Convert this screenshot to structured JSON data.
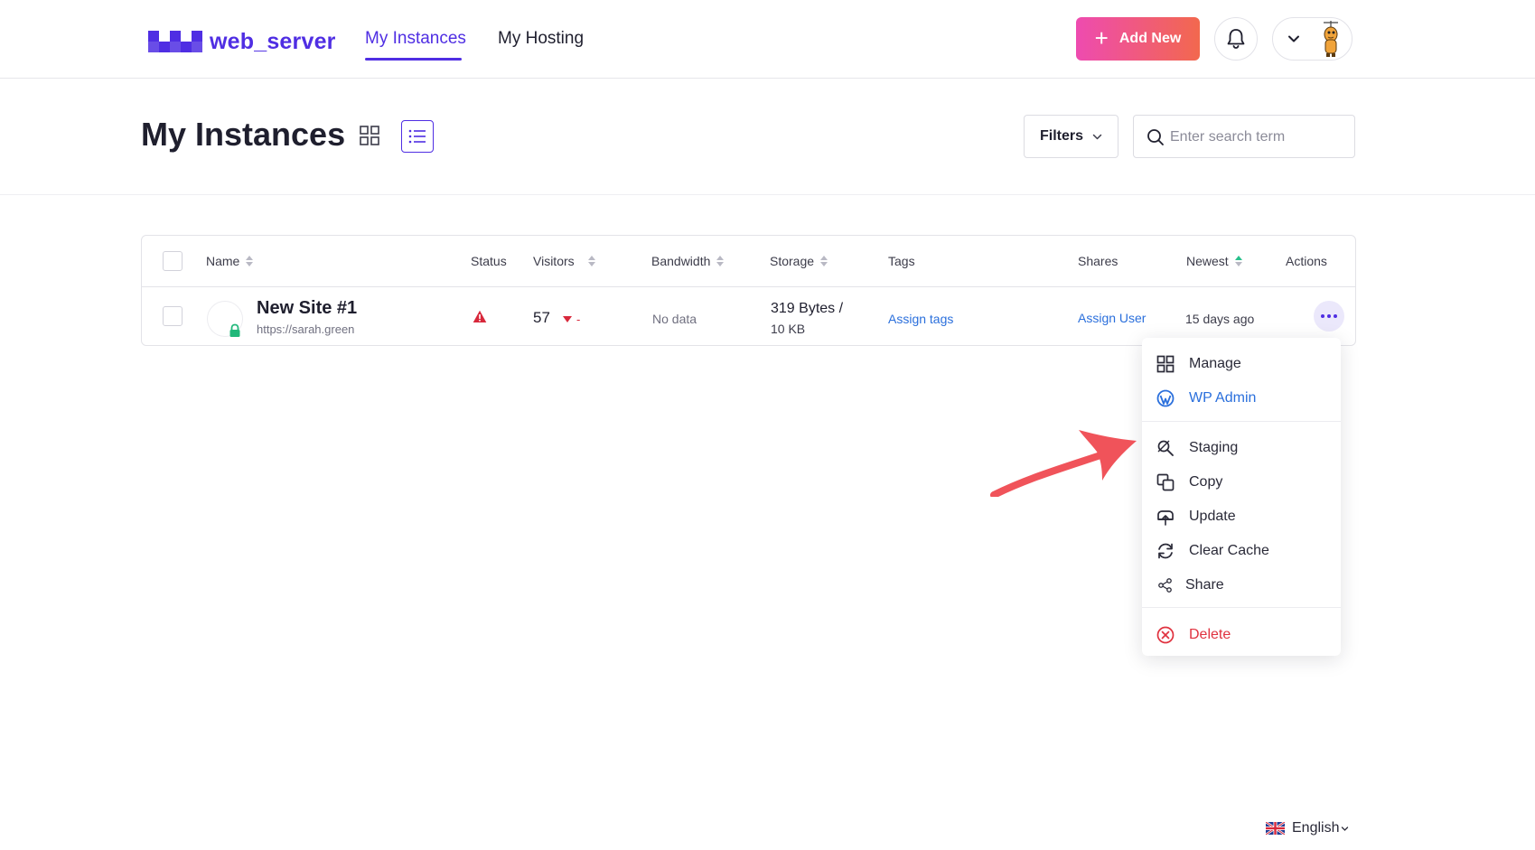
{
  "header": {
    "logo_text": "web_server",
    "tabs": [
      {
        "label": "My Instances",
        "active": true
      },
      {
        "label": "My Hosting",
        "active": false
      }
    ],
    "add_button_label": "Add New",
    "accent_color": "#4f2ee3"
  },
  "page": {
    "title": "My Instances",
    "filters_label": "Filters",
    "search_placeholder": "Enter search term"
  },
  "table": {
    "columns": [
      "Name",
      "Status",
      "Visitors",
      "Bandwidth",
      "Storage",
      "Tags",
      "Shares",
      "Newest",
      "Actions"
    ],
    "rows": [
      {
        "name": "New Site #1",
        "url": "https://sarah.green",
        "status_icon": "warning-icon",
        "visitors": "57",
        "visitors_trend": "-",
        "bandwidth": "No data",
        "storage": "319 Bytes /",
        "storage_limit": "10 KB",
        "tags": "Assign tags",
        "shares": "Assign User",
        "newest": "15 days ago"
      }
    ]
  },
  "actions_menu": {
    "items": [
      {
        "label": "Manage",
        "icon": "grid-icon"
      },
      {
        "label": "WP Admin",
        "icon": "wordpress-icon",
        "color": "#2a6fdc"
      },
      {
        "label": "Staging",
        "icon": "staging-icon"
      },
      {
        "label": "Copy",
        "icon": "copy-icon"
      },
      {
        "label": "Update",
        "icon": "update-icon"
      },
      {
        "label": "Clear Cache",
        "icon": "refresh-icon"
      },
      {
        "label": "Share",
        "icon": "share-icon"
      },
      {
        "label": "Delete",
        "icon": "delete-icon",
        "color": "#e0323f"
      }
    ]
  },
  "footer": {
    "language": "English"
  }
}
